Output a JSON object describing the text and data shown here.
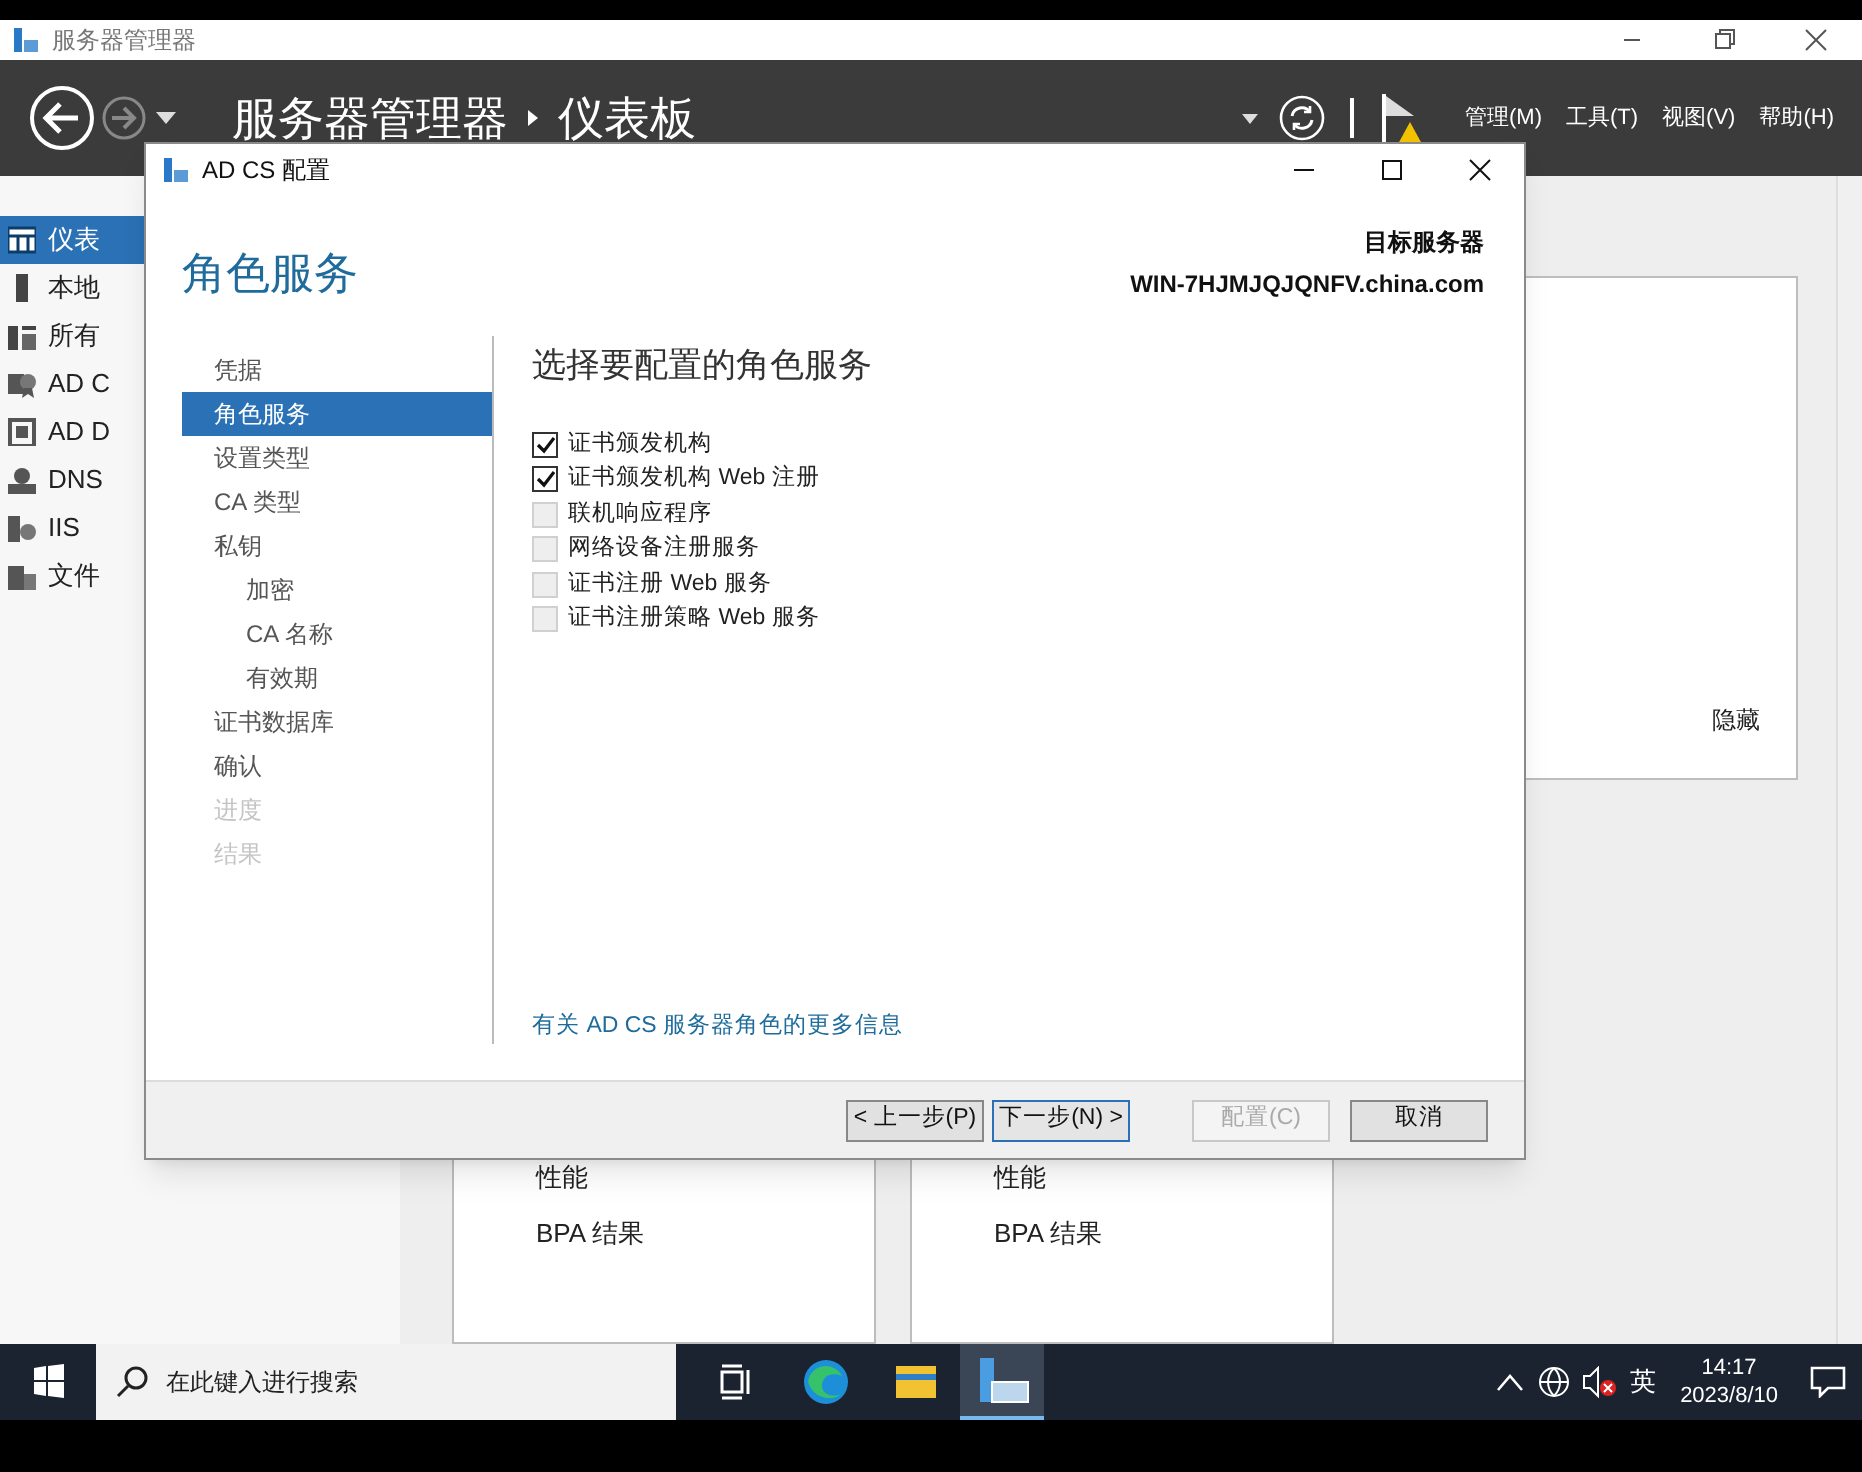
{
  "server_manager": {
    "title": "服务器管理器",
    "breadcrumb": [
      "服务器管理器",
      "仪表板"
    ],
    "menus": [
      "管理(M)",
      "工具(T)",
      "视图(V)",
      "帮助(H)"
    ],
    "nav": [
      {
        "label": "仪表",
        "selected": true
      },
      {
        "label": "本地",
        "selected": false
      },
      {
        "label": "所有",
        "selected": false
      },
      {
        "label": "AD C",
        "selected": false
      },
      {
        "label": "AD D",
        "selected": false
      },
      {
        "label": "DNS",
        "selected": false
      },
      {
        "label": "IIS",
        "selected": false
      },
      {
        "label": "文件",
        "selected": false
      }
    ],
    "panel_link": "隐藏",
    "tiles": [
      {
        "items": [
          "性能",
          "BPA 结果"
        ]
      },
      {
        "items": [
          "性能",
          "BPA 结果"
        ]
      }
    ]
  },
  "dialog": {
    "title": "AD CS 配置",
    "page_title": "角色服务",
    "target_label": "目标服务器",
    "target_server": "WIN-7HJMJQJQNFV.china.com",
    "steps": [
      {
        "label": "凭据",
        "selected": false,
        "disabled": false
      },
      {
        "label": "角色服务",
        "selected": true,
        "disabled": false
      },
      {
        "label": "设置类型",
        "selected": false,
        "disabled": false
      },
      {
        "label": "CA 类型",
        "selected": false,
        "disabled": false
      },
      {
        "label": "私钥",
        "selected": false,
        "disabled": false,
        "children": [
          {
            "label": "加密",
            "selected": false,
            "disabled": false
          },
          {
            "label": "CA 名称",
            "selected": false,
            "disabled": false
          },
          {
            "label": "有效期",
            "selected": false,
            "disabled": false
          }
        ]
      },
      {
        "label": "证书数据库",
        "selected": false,
        "disabled": false
      },
      {
        "label": "确认",
        "selected": false,
        "disabled": false
      },
      {
        "label": "进度",
        "selected": false,
        "disabled": true
      },
      {
        "label": "结果",
        "selected": false,
        "disabled": true
      }
    ],
    "heading": "选择要配置的角色服务",
    "options": [
      {
        "label": "证书颁发机构",
        "checked": true
      },
      {
        "label": "证书颁发机构 Web 注册",
        "checked": true
      },
      {
        "label": "联机响应程序",
        "checked": false
      },
      {
        "label": "网络设备注册服务",
        "checked": false
      },
      {
        "label": "证书注册 Web 服务",
        "checked": false
      },
      {
        "label": "证书注册策略 Web 服务",
        "checked": false
      }
    ],
    "more_info_link": "有关 AD CS 服务器角色的更多信息",
    "buttons": [
      {
        "label": "< 上一步(P)",
        "disabled": false,
        "default": false
      },
      {
        "label": "下一步(N) >",
        "disabled": false,
        "default": true
      },
      {
        "label": "配置(C)",
        "disabled": true,
        "default": false
      },
      {
        "label": "取消",
        "disabled": false,
        "default": false
      }
    ]
  },
  "taskbar": {
    "search_placeholder": "在此键入进行搜索",
    "ime": "英",
    "time": "14:17",
    "date": "2023/8/10"
  }
}
